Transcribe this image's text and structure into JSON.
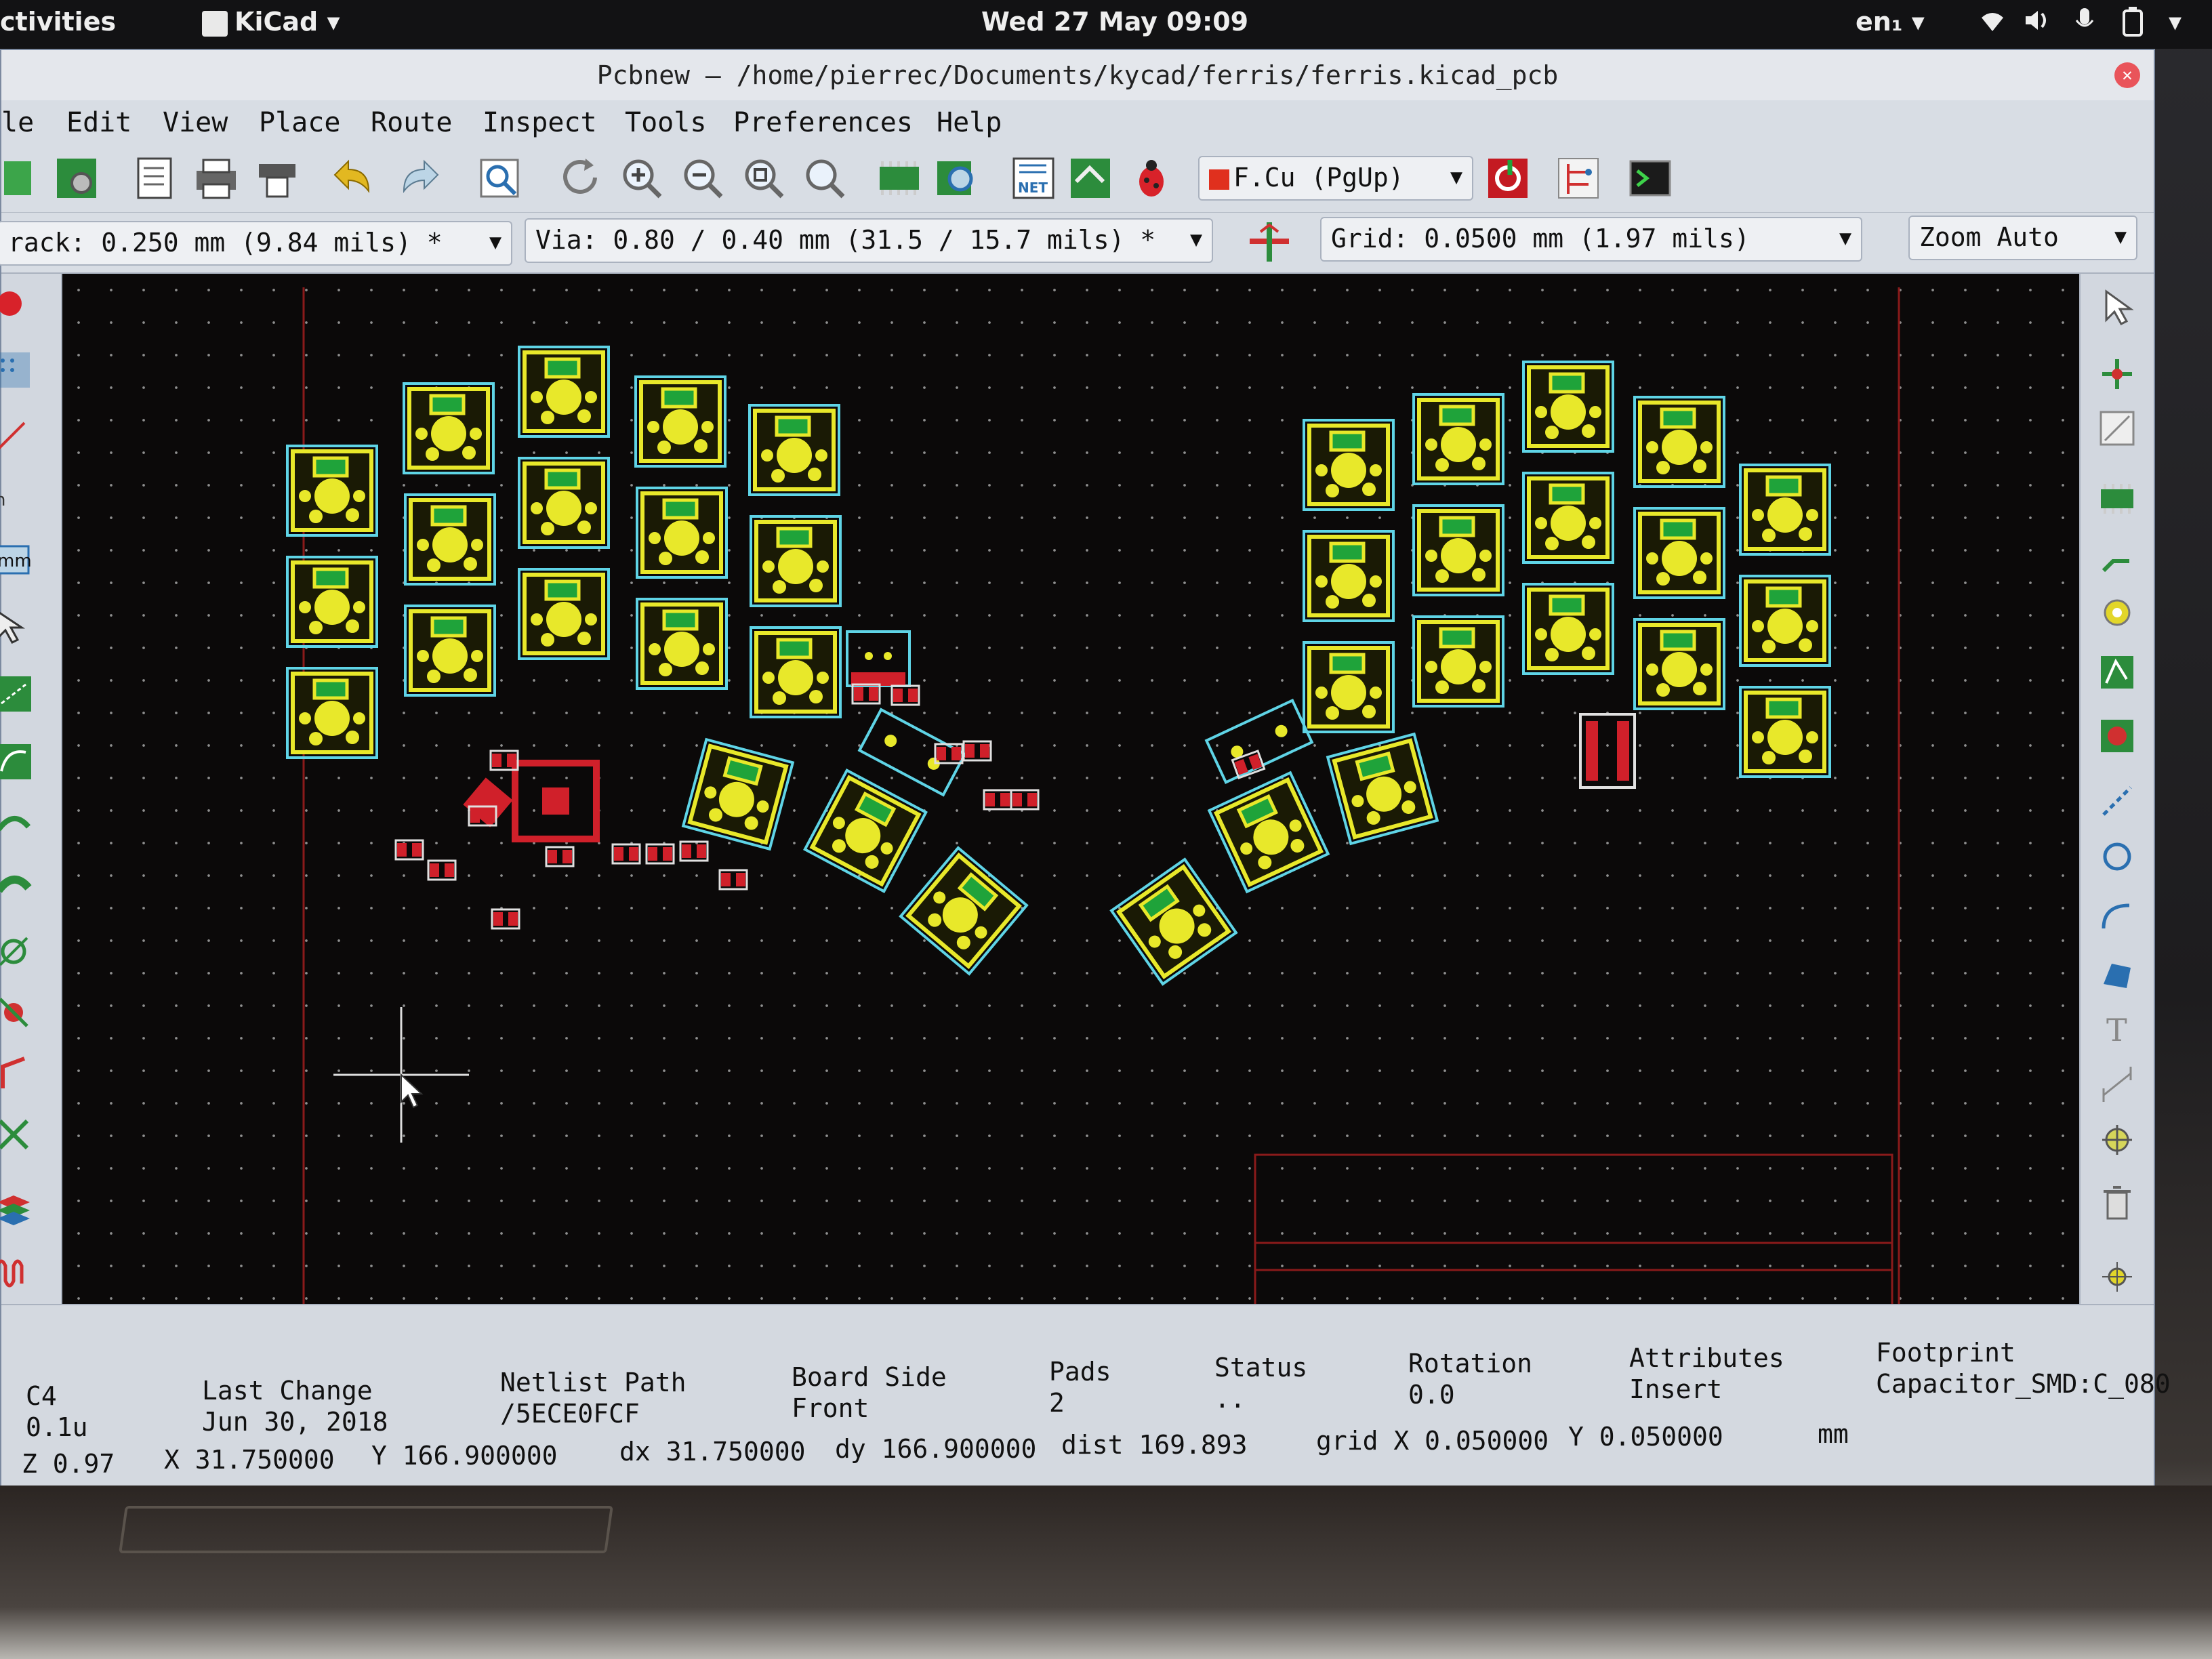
{
  "topbar": {
    "activities": "ctivities",
    "app_menu": "KiCad",
    "datetime": "Wed 27 May 09:09",
    "keyboard": "en₁"
  },
  "window": {
    "title": "Pcbnew — /home/pierrec/Documents/kycad/ferris/ferris.kicad_pcb"
  },
  "menu": {
    "items": [
      "le",
      "Edit",
      "View",
      "Place",
      "Route",
      "Inspect",
      "Tools",
      "Preferences",
      "Help"
    ]
  },
  "toolbar": {
    "layer_select": "F.Cu (PgUp)",
    "layer_color": "#e0301e"
  },
  "options": {
    "track": "rack: 0.250 mm (9.84 mils) *",
    "via": "Via: 0.80 / 0.40 mm (31.5 / 15.7 mils) *",
    "grid": "Grid: 0.0500 mm (1.97 mils)",
    "zoom": "Zoom Auto"
  },
  "status": {
    "ref": "C4",
    "value": "0.1u",
    "last_change_label": "Last Change",
    "last_change_value": "Jun 30, 2018",
    "netlist_label": "Netlist Path",
    "netlist_value": "/5ECE0FCF",
    "side_label": "Board Side",
    "side_value": "Front",
    "pads_label": "Pads",
    "pads_value": "2",
    "status_label": "Status",
    "status_value": "..",
    "rotation_label": "Rotation",
    "rotation_value": "0.0",
    "attributes_label": "Attributes",
    "attributes_value": "Insert",
    "footprint_label": "Footprint",
    "footprint_value": "Capacitor_SMD:C_080",
    "zoom_readout": "Z 0.97",
    "x_readout": "X 31.750000",
    "y_readout": "Y 166.900000",
    "dx_readout": "dx 31.750000",
    "dy_readout": "dy 166.900000",
    "dist_readout": "dist 169.893",
    "grid_x": "grid X 0.050000",
    "grid_y": "Y 0.050000",
    "units": "mm"
  },
  "colors": {
    "canvas_bg": "#0b0909",
    "pad": "#e8e82a",
    "outline": "#5fd4e6",
    "copper_red": "#d0202a",
    "silk_green": "#1fa33a",
    "board_edge": "#8a1a1a"
  }
}
